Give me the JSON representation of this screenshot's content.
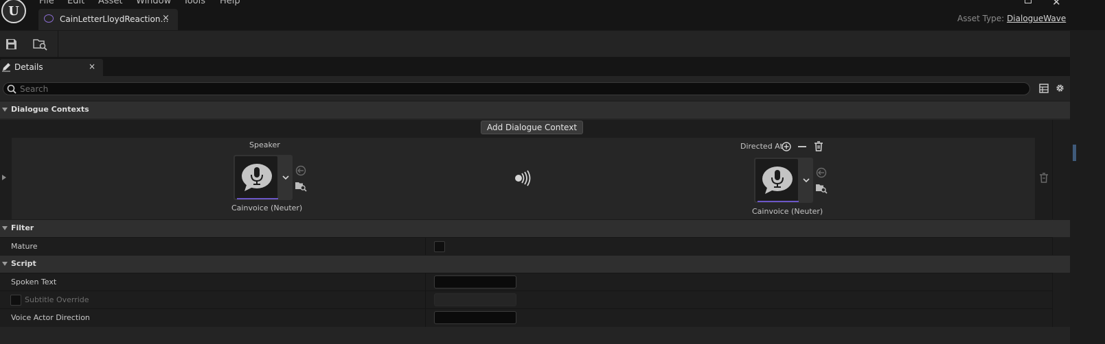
{
  "menu": [
    "File",
    "Edit",
    "Asset",
    "Window",
    "Tools",
    "Help"
  ],
  "logo_text": "U",
  "tab": {
    "label": "CainLetterLloydReaction…",
    "close": "×"
  },
  "window_controls": {
    "minimize": "–",
    "close": "✕"
  },
  "asset_type": {
    "label": "Asset Type:",
    "value": "DialogueWave"
  },
  "details_tab": {
    "label": "Details",
    "close": "×"
  },
  "search": {
    "placeholder": "Search"
  },
  "sections": {
    "dialogue_contexts": "Dialogue Contexts",
    "filter": "Filter",
    "script": "Script"
  },
  "dialogue_context": {
    "add_button": "Add Dialogue Context",
    "speaker_header": "Speaker",
    "speaker_name": "Cainvoice (Neuter)",
    "directed_at_header": "Directed At",
    "directed_at_name": "Cainvoice (Neuter)"
  },
  "filter": {
    "mature_label": "Mature",
    "mature_checked": false
  },
  "script": {
    "spoken_text_label": "Spoken Text",
    "spoken_text_value": "",
    "subtitle_override_label": "Subtitle Override",
    "subtitle_override_checked": false,
    "voice_actor_direction_label": "Voice Actor Direction",
    "voice_actor_direction_value": ""
  },
  "colors": {
    "accent": "#6c57c9",
    "panel": "#242424",
    "background": "#151515"
  }
}
